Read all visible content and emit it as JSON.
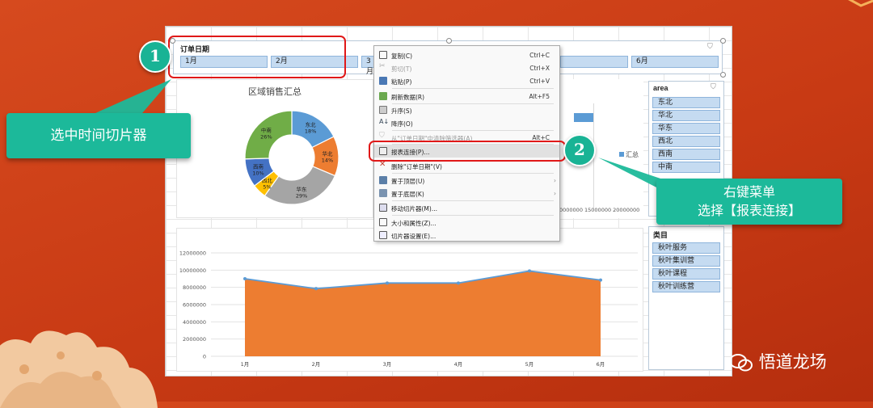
{
  "date_slicer": {
    "title": "订单日期",
    "months": [
      "1月",
      "2月",
      "3月",
      "6月"
    ]
  },
  "pie_chart": {
    "title": "区域销售汇总"
  },
  "context_menu": {
    "items": [
      {
        "label": "复制(C)",
        "shortcut": "Ctrl+C",
        "icon": "copy-icon",
        "disabled": false
      },
      {
        "label": "剪切(T)",
        "shortcut": "Ctrl+X",
        "icon": "cut-icon",
        "disabled": true
      },
      {
        "label": "粘贴(P)",
        "shortcut": "Ctrl+V",
        "icon": "paste-icon",
        "disabled": false
      },
      {
        "label": "刷新数据(R)",
        "shortcut": "Alt+F5",
        "icon": "refresh-icon",
        "disabled": false
      },
      {
        "label": "升序(S)",
        "shortcut": "",
        "icon": "sort-asc-icon",
        "disabled": false
      },
      {
        "label": "降序(O)",
        "shortcut": "",
        "icon": "sort-desc-icon",
        "disabled": false
      },
      {
        "label": "从\"订单日期\"中清除筛选器(A)",
        "shortcut": "Alt+C",
        "icon": "clear-filter-icon",
        "disabled": true
      },
      {
        "label": "报表连接(P)...",
        "shortcut": "",
        "icon": "report-connection-icon",
        "disabled": false,
        "highlighted": true
      },
      {
        "label": "删除\"订单日期\"(V)",
        "shortcut": "",
        "icon": "delete-icon",
        "disabled": false
      },
      {
        "label": "置于顶层(U)",
        "shortcut": "",
        "icon": "bring-front-icon",
        "disabled": false,
        "submenu": true
      },
      {
        "label": "置于底层(K)",
        "shortcut": "",
        "icon": "send-back-icon",
        "disabled": false,
        "submenu": true
      },
      {
        "label": "移动切片器(M)...",
        "shortcut": "",
        "icon": "move-slicer-icon",
        "disabled": false
      },
      {
        "label": "大小和属性(Z)...",
        "shortcut": "",
        "icon": "size-properties-icon",
        "disabled": false
      },
      {
        "label": "切片器设置(E)...",
        "shortcut": "",
        "icon": "slicer-settings-icon",
        "disabled": false
      }
    ]
  },
  "bar_chart": {
    "legend": "汇总",
    "axis_tick_text": "0000000 15000000 20000000"
  },
  "area_slicer": {
    "title": "area",
    "items": [
      "东北",
      "华北",
      "华东",
      "西北",
      "西南",
      "中南"
    ]
  },
  "category_slicer": {
    "title": "类目",
    "items": [
      "秋叶服务",
      "秋叶集训营",
      "秋叶课程",
      "秋叶训练营"
    ]
  },
  "annotations": {
    "step1": "1",
    "step2": "2",
    "callout1": "选中时间切片器",
    "callout2_line1": "右键菜单",
    "callout2_line2": "选择【报表连接】"
  },
  "watermark": "悟道龙场",
  "chart_data": [
    {
      "type": "pie",
      "title": "区域销售汇总",
      "variant": "donut",
      "slices": [
        {
          "name": "东北",
          "value": 18,
          "label": "18%",
          "color": "#5b9bd5"
        },
        {
          "name": "华北",
          "value": 14,
          "label": "14%",
          "color": "#ed7d31"
        },
        {
          "name": "华东",
          "value": 29,
          "label": "29%",
          "color": "#a5a5a5"
        },
        {
          "name": "西北",
          "value": 5,
          "label": "5%",
          "color": "#ffc000"
        },
        {
          "name": "西南",
          "value": 10,
          "label": "10%",
          "color": "#4472c4"
        },
        {
          "name": "中南",
          "value": 26,
          "label": "26%",
          "color": "#70ad47"
        }
      ]
    },
    {
      "type": "area",
      "categories": [
        "1月",
        "2月",
        "3月",
        "4月",
        "5月",
        "6月"
      ],
      "values": [
        9000000,
        7850000,
        8500000,
        8500000,
        9900000,
        8850000
      ],
      "ylim": [
        0,
        12000000
      ],
      "yticks": [
        "0",
        "2000000",
        "4000000",
        "6000000",
        "8000000",
        "10000000",
        "12000000"
      ],
      "grid": true,
      "fill_color": "#ed7d31",
      "line_color": "#5b9bd5"
    }
  ],
  "colors": {
    "background": "#c83a14",
    "accent_teal": "#1cb99a",
    "highlight_red": "#e01818",
    "slicer_item": "#c5dbf1"
  }
}
